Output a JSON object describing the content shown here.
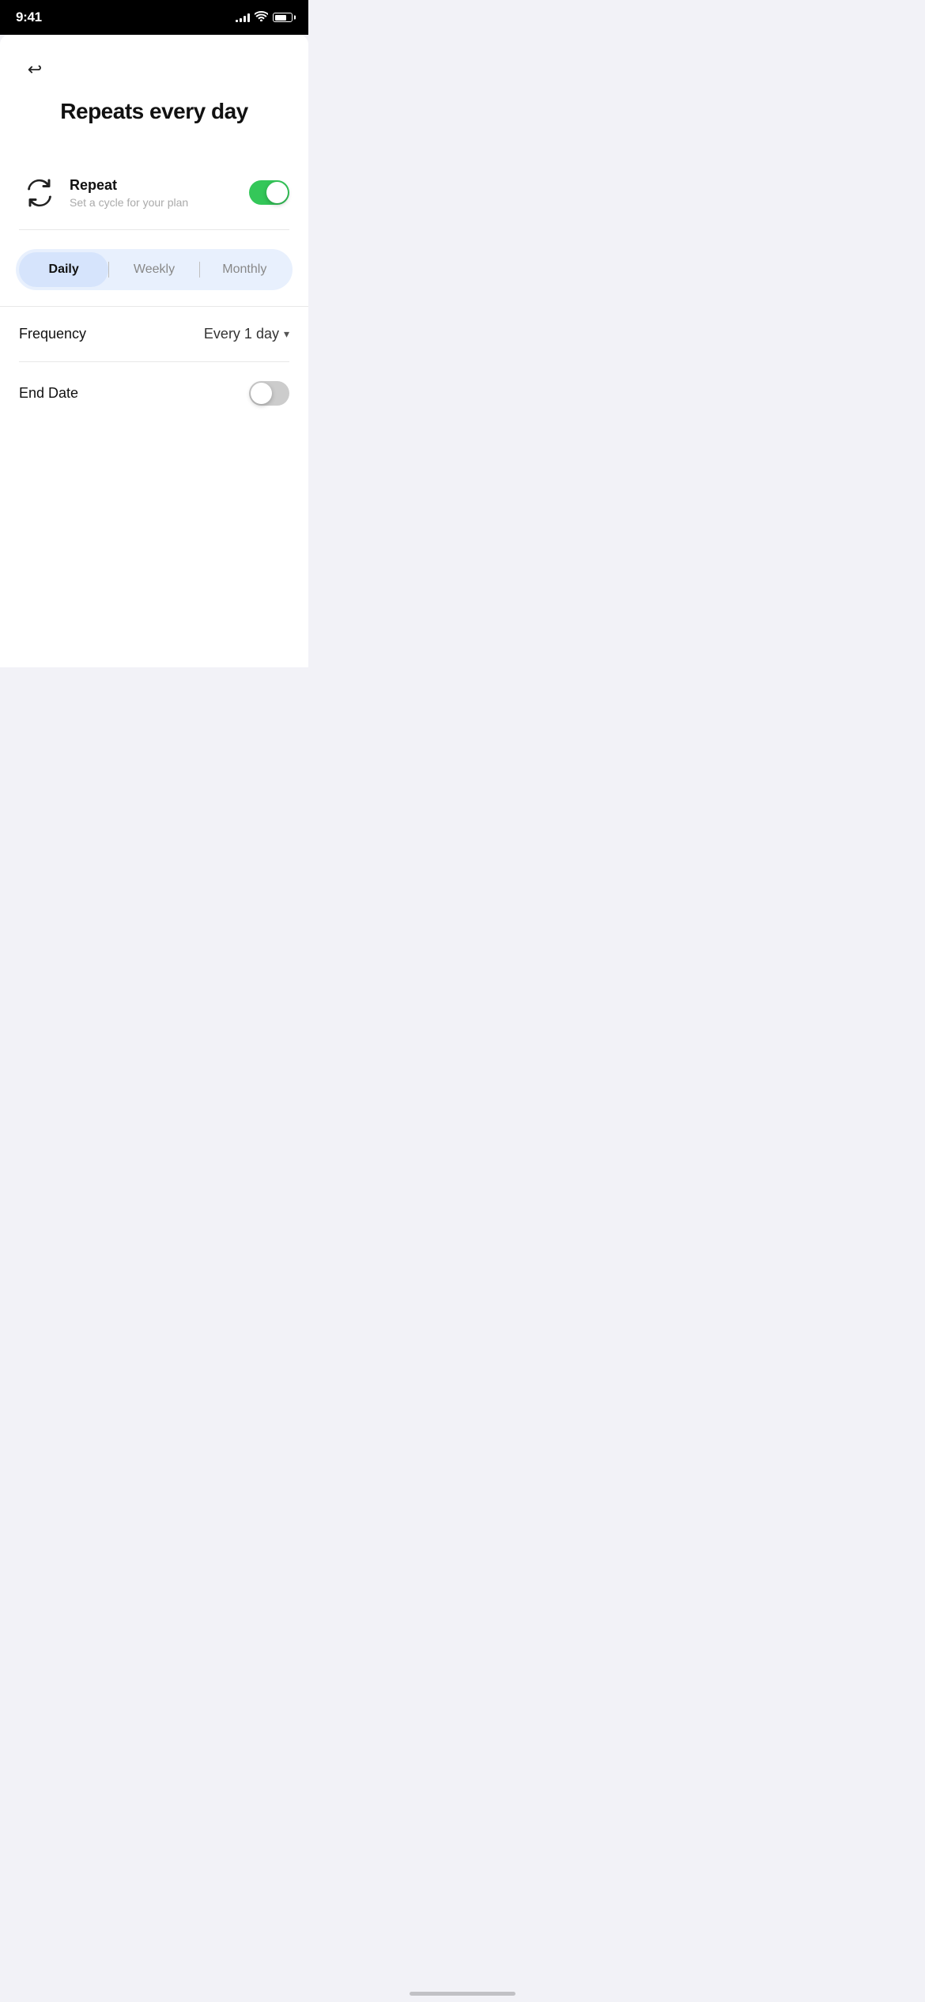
{
  "statusBar": {
    "time": "9:41",
    "signalBars": [
      3,
      6,
      9,
      12,
      12
    ],
    "wifiSymbol": "wifi",
    "battery": 70
  },
  "header": {
    "backLabel": "←",
    "title": "Repeats every day"
  },
  "repeatSection": {
    "iconLabel": "repeat-icon",
    "label": "Repeat",
    "sublabel": "Set a cycle for your plan",
    "toggleOn": true
  },
  "tabs": [
    {
      "id": "daily",
      "label": "Daily",
      "active": true
    },
    {
      "id": "weekly",
      "label": "Weekly",
      "active": false
    },
    {
      "id": "monthly",
      "label": "Monthly",
      "active": false
    }
  ],
  "frequencyRow": {
    "label": "Frequency",
    "value": "Every 1  day",
    "chevron": "▾"
  },
  "endDateRow": {
    "label": "End Date",
    "toggleOn": false
  }
}
